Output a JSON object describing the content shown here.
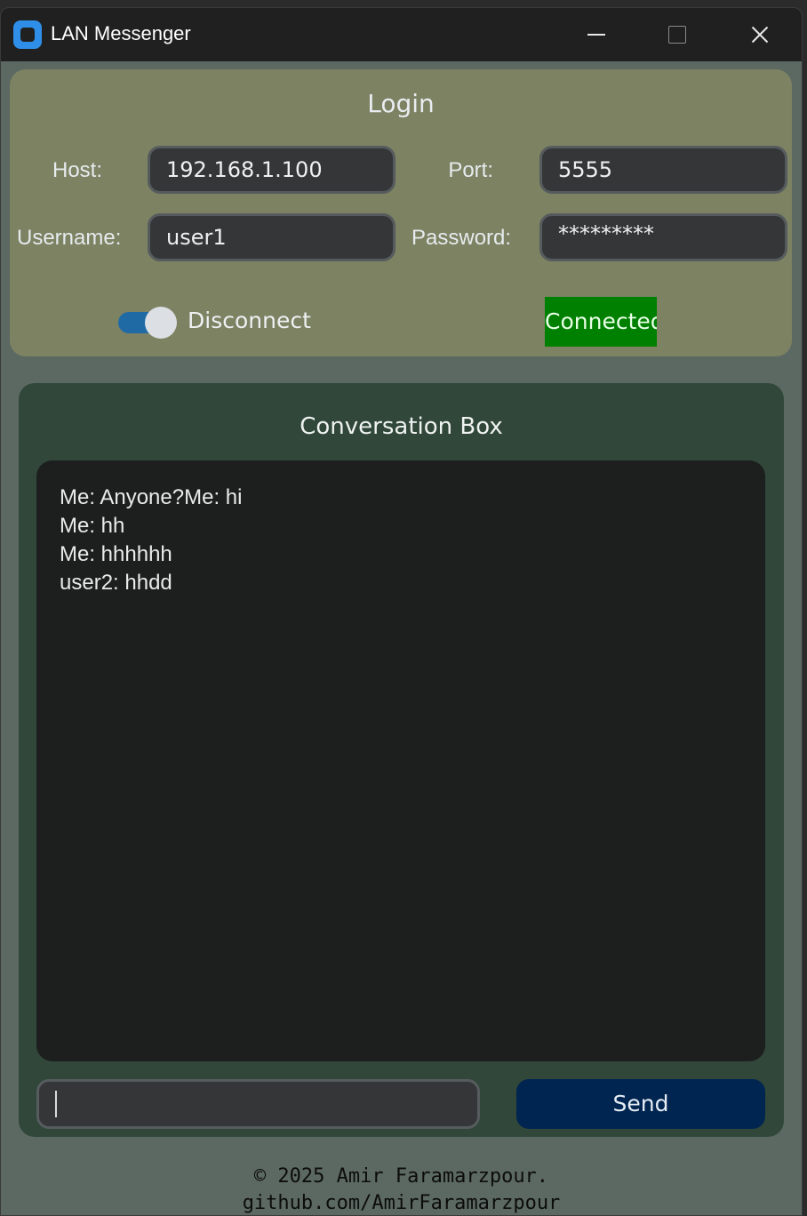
{
  "window": {
    "title": "LAN Messenger"
  },
  "login": {
    "title": "Login",
    "host_label": "Host:",
    "host_value": "192.168.1.100",
    "port_label": "Port:",
    "port_value": "5555",
    "username_label": "Username:",
    "username_value": "user1",
    "password_label": "Password:",
    "password_value": "*********",
    "toggle_label": "Disconnect",
    "toggle_on": true,
    "status": "Connected",
    "colors": {
      "panel": "#7c8262",
      "status_bg": "#008000",
      "toggle": "#1f6aa5"
    }
  },
  "conversation": {
    "title": "Conversation Box",
    "messages": [
      "Me: Anyone?Me: hi",
      "Me: hh",
      "Me: hhhhhh",
      "user2: hhdd"
    ],
    "input_value": "",
    "send_label": "Send",
    "colors": {
      "panel": "#31473a",
      "send_bg": "#002550"
    }
  },
  "footer": {
    "line1": "© 2025 Amir Faramarzpour.",
    "line2": "github.com/AmirFaramarzpour"
  },
  "icons": [
    "app-icon",
    "minimize-icon",
    "maximize-icon",
    "close-icon"
  ]
}
